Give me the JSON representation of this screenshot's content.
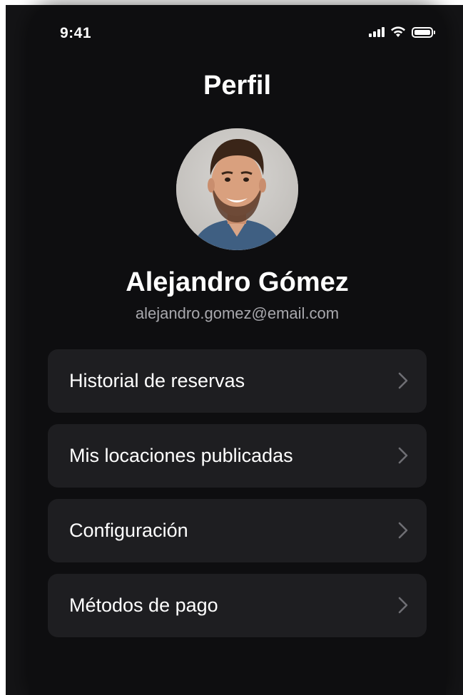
{
  "status_bar": {
    "time": "9:41",
    "icons": [
      "signal-icon",
      "wifi-icon",
      "battery-icon"
    ]
  },
  "header": {
    "title": "Perfil"
  },
  "profile": {
    "name": "Alejandro Gómez",
    "email": "alejandro.gomez@email.com",
    "avatar": "avatar-photo"
  },
  "menu": {
    "items": [
      {
        "label": "Historial de reservas",
        "icon": "chevron-right-icon"
      },
      {
        "label": "Mis locaciones publicadas",
        "icon": "chevron-right-icon"
      },
      {
        "label": "Configuración",
        "icon": "chevron-right-icon"
      },
      {
        "label": "Métodos de pago",
        "icon": "chevron-right-icon"
      }
    ]
  },
  "colors": {
    "background": "#0e0e10",
    "card": "#1e1e21",
    "text_primary": "#ffffff",
    "text_secondary": "#a8a8ad",
    "chevron": "#6e6e73"
  }
}
